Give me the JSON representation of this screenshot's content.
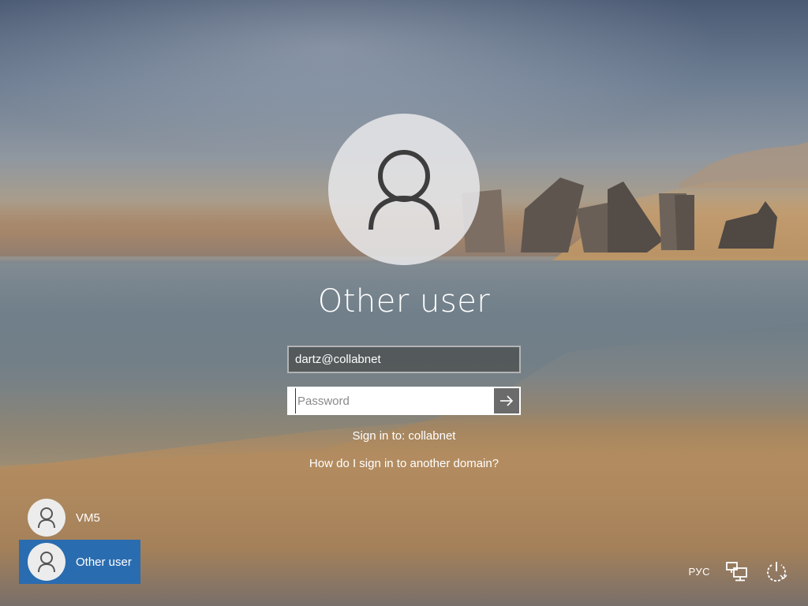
{
  "login": {
    "user_title": "Other user",
    "username_value": "dartz@collabnet",
    "password_placeholder": "Password",
    "sign_in_to": "Sign in to: collabnet",
    "domain_help_link": "How do I sign in to another domain?"
  },
  "user_list": [
    {
      "label": "VM5",
      "selected": false
    },
    {
      "label": "Other user",
      "selected": true
    }
  ],
  "status_bar": {
    "language": "РУС",
    "network_icon": "network-icon",
    "power_icon": "power-icon"
  },
  "colors": {
    "selected_tile": "#2a6cb0",
    "submit_button": "#6b6b6b"
  }
}
